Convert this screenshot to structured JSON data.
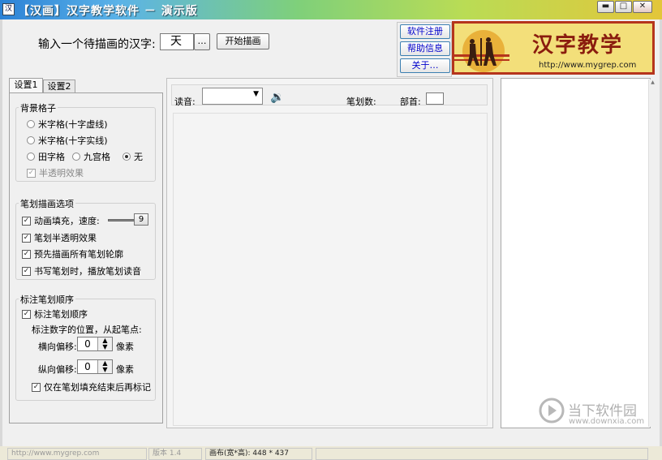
{
  "window": {
    "title": "【汉画】汉字教学软件 － 演示版",
    "controls": {
      "min": "▬",
      "max": "□",
      "close": "✕"
    }
  },
  "top": {
    "prompt_label": "输入一个待描画的汉字:",
    "char_value": "天",
    "browse_label": "…",
    "start_label": "开始描画",
    "register_label": "软件注册",
    "help_label": "帮助信息",
    "about_label": "关于…"
  },
  "logo": {
    "text": "汉字教学",
    "url": "http://www.mygrep.com"
  },
  "tabs": [
    {
      "label": "设置1"
    },
    {
      "label": "设置2"
    }
  ],
  "grid": {
    "title": "背景格子",
    "options": [
      {
        "label": "米字格(十字虚线)"
      },
      {
        "label": "米字格(十字实线)"
      },
      {
        "label": "田字格"
      },
      {
        "label": "九宫格"
      },
      {
        "label": "无"
      }
    ],
    "translucent_label": "半透明效果"
  },
  "stroke": {
    "title": "笔划描画选项",
    "anim_label": "动画填充，速度:",
    "speed_value": "9",
    "semi_label": "笔划半透明效果",
    "outline_label": "预先描画所有笔划轮廓",
    "read_label": "书写笔划时，播放笔划读音"
  },
  "order": {
    "title": "标注笔划顺序",
    "enable_label": "标注笔划顺序",
    "position_label": "标注数字的位置，从起笔点:",
    "h_label": "横向偏移:",
    "h_value": "0",
    "v_label": "纵向偏移:",
    "v_value": "0",
    "unit": "像素",
    "after_label": "仅在笔划填充结束后再标记"
  },
  "canvas": {
    "reading_label": "读音:",
    "stroke_count_label": "笔划数:",
    "radical_label": "部首:"
  },
  "status": {
    "url": "http://www.mygrep.com",
    "version": "版本  1.4",
    "canvas_size": "画布(宽*高): 448 * 437"
  },
  "watermark": {
    "brand": "当下软件园",
    "url": "www.downxia.com"
  },
  "colors": {
    "title_start": "#2c82d6",
    "title_end": "#e3c63a",
    "logo_bg": "#f3df7a",
    "logo_frame": "#b5341c",
    "link_blue": "#0000cc"
  }
}
